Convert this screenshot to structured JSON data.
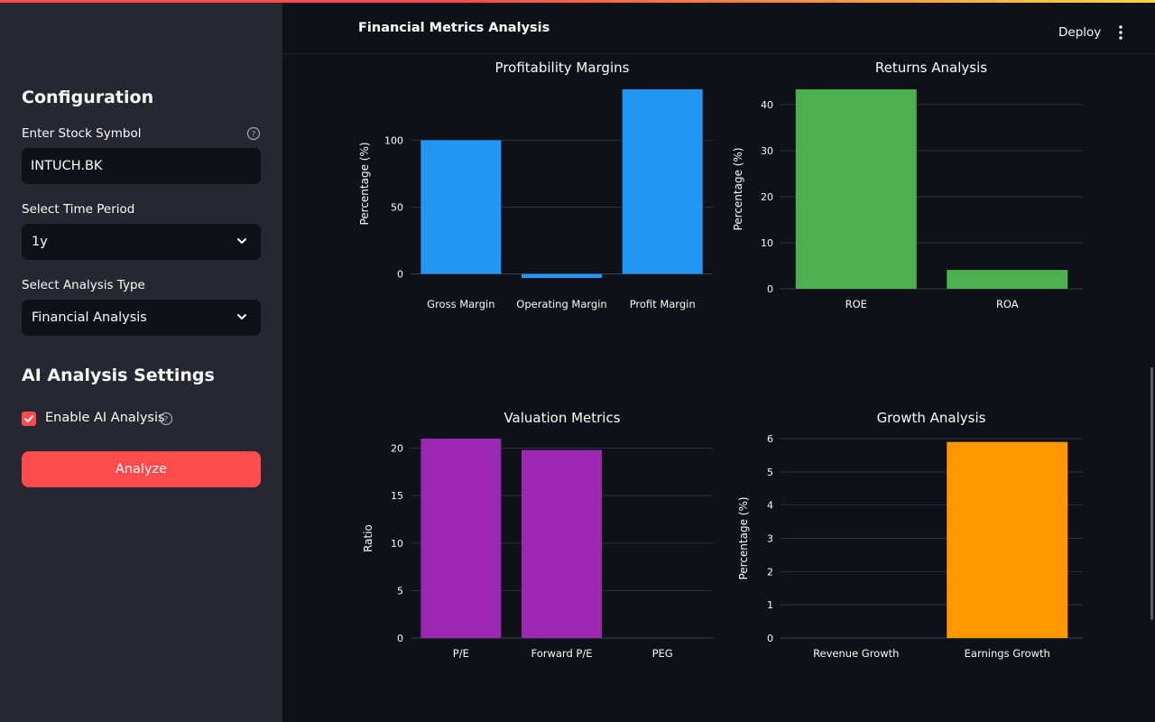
{
  "sidebar": {
    "configuration_heading": "Configuration",
    "stock_symbol_label": "Enter Stock Symbol",
    "stock_symbol_value": "INTUCH.BK",
    "time_period_label": "Select Time Period",
    "time_period_value": "1y",
    "analysis_type_label": "Select Analysis Type",
    "analysis_type_value": "Financial Analysis",
    "ai_heading": "AI Analysis Settings",
    "enable_ai_label": "Enable AI Analysis",
    "enable_ai_checked": true,
    "analyze_button": "Analyze"
  },
  "header": {
    "title": "Financial Metrics Analysis",
    "deploy_label": "Deploy"
  },
  "icons": {
    "help": "help-circle-icon",
    "chevron": "chevron-down-icon",
    "check": "check-icon",
    "menu": "more-vertical-icon"
  },
  "colors": {
    "accent": "#ff4b4b",
    "sidebar_bg": "#262730",
    "app_bg": "#0e1117",
    "profitability_bar": "#2196f3",
    "returns_bar": "#4caf50",
    "valuation_bar": "#9c27b0",
    "growth_bar": "#ff9800"
  },
  "chart_data": [
    {
      "type": "bar",
      "title": "Profitability Margins",
      "ylabel": "Percentage (%)",
      "categories": [
        "Gross Margin",
        "Operating Margin",
        "Profit Margin"
      ],
      "values": [
        100,
        -3,
        138
      ],
      "ylim": [
        -3,
        138
      ],
      "yticks": [
        0,
        50,
        100
      ],
      "grid": true,
      "color": "#2196f3"
    },
    {
      "type": "bar",
      "title": "Returns Analysis",
      "ylabel": "Percentage (%)",
      "categories": [
        "ROE",
        "ROA"
      ],
      "values": [
        43.3,
        4.1
      ],
      "ylim": [
        0,
        43.3
      ],
      "yticks": [
        0,
        10,
        20,
        30,
        40
      ],
      "grid": true,
      "color": "#4caf50"
    },
    {
      "type": "bar",
      "title": "Valuation Metrics",
      "ylabel": "Ratio",
      "categories": [
        "P/E",
        "Forward P/E",
        "PEG"
      ],
      "values": [
        21,
        19.8,
        0
      ],
      "ylim": [
        0,
        21
      ],
      "yticks": [
        0,
        5,
        10,
        15,
        20
      ],
      "grid": true,
      "color": "#9c27b0"
    },
    {
      "type": "bar",
      "title": "Growth Analysis",
      "ylabel": "Percentage (%)",
      "categories": [
        "Revenue Growth",
        "Earnings Growth"
      ],
      "values": [
        0,
        5.9
      ],
      "ylim": [
        0,
        6
      ],
      "yticks": [
        0,
        1,
        2,
        3,
        4,
        5,
        6
      ],
      "grid": true,
      "color": "#ff9800"
    }
  ]
}
